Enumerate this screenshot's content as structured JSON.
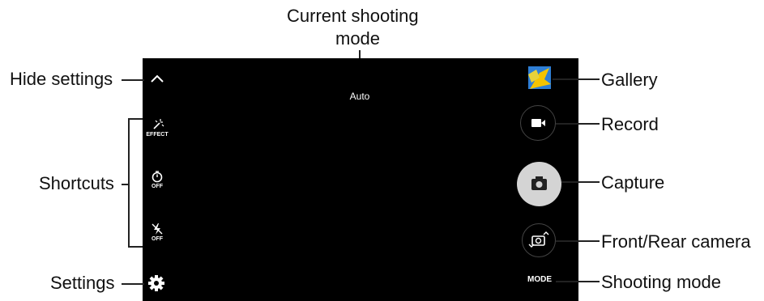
{
  "screen": {
    "current_mode": "Auto",
    "mode_button": "MODE",
    "shortcuts": {
      "effect_label": "EFFECT",
      "timer_label": "OFF",
      "flash_label": "OFF"
    }
  },
  "callouts": {
    "current_shooting_mode_line1": "Current shooting",
    "current_shooting_mode_line2": "mode",
    "hide_settings": "Hide settings",
    "shortcuts": "Shortcuts",
    "settings": "Settings",
    "gallery": "Gallery",
    "record": "Record",
    "capture": "Capture",
    "front_rear_camera": "Front/Rear camera",
    "shooting_mode": "Shooting mode"
  },
  "colors": {
    "screen_bg": "#000000",
    "capture_button": "#d4d4d4",
    "gallery_yellow": "#f5c400",
    "gallery_blue": "#2f7fd6"
  },
  "icons": {
    "hide": "chevron-up-icon",
    "effect": "magic-wand-icon",
    "timer": "timer-icon",
    "flash": "flash-off-icon",
    "settings": "gear-icon",
    "gallery": "gallery-thumbnail-icon",
    "record": "video-camera-icon",
    "capture": "camera-icon",
    "switch": "switch-camera-icon"
  }
}
